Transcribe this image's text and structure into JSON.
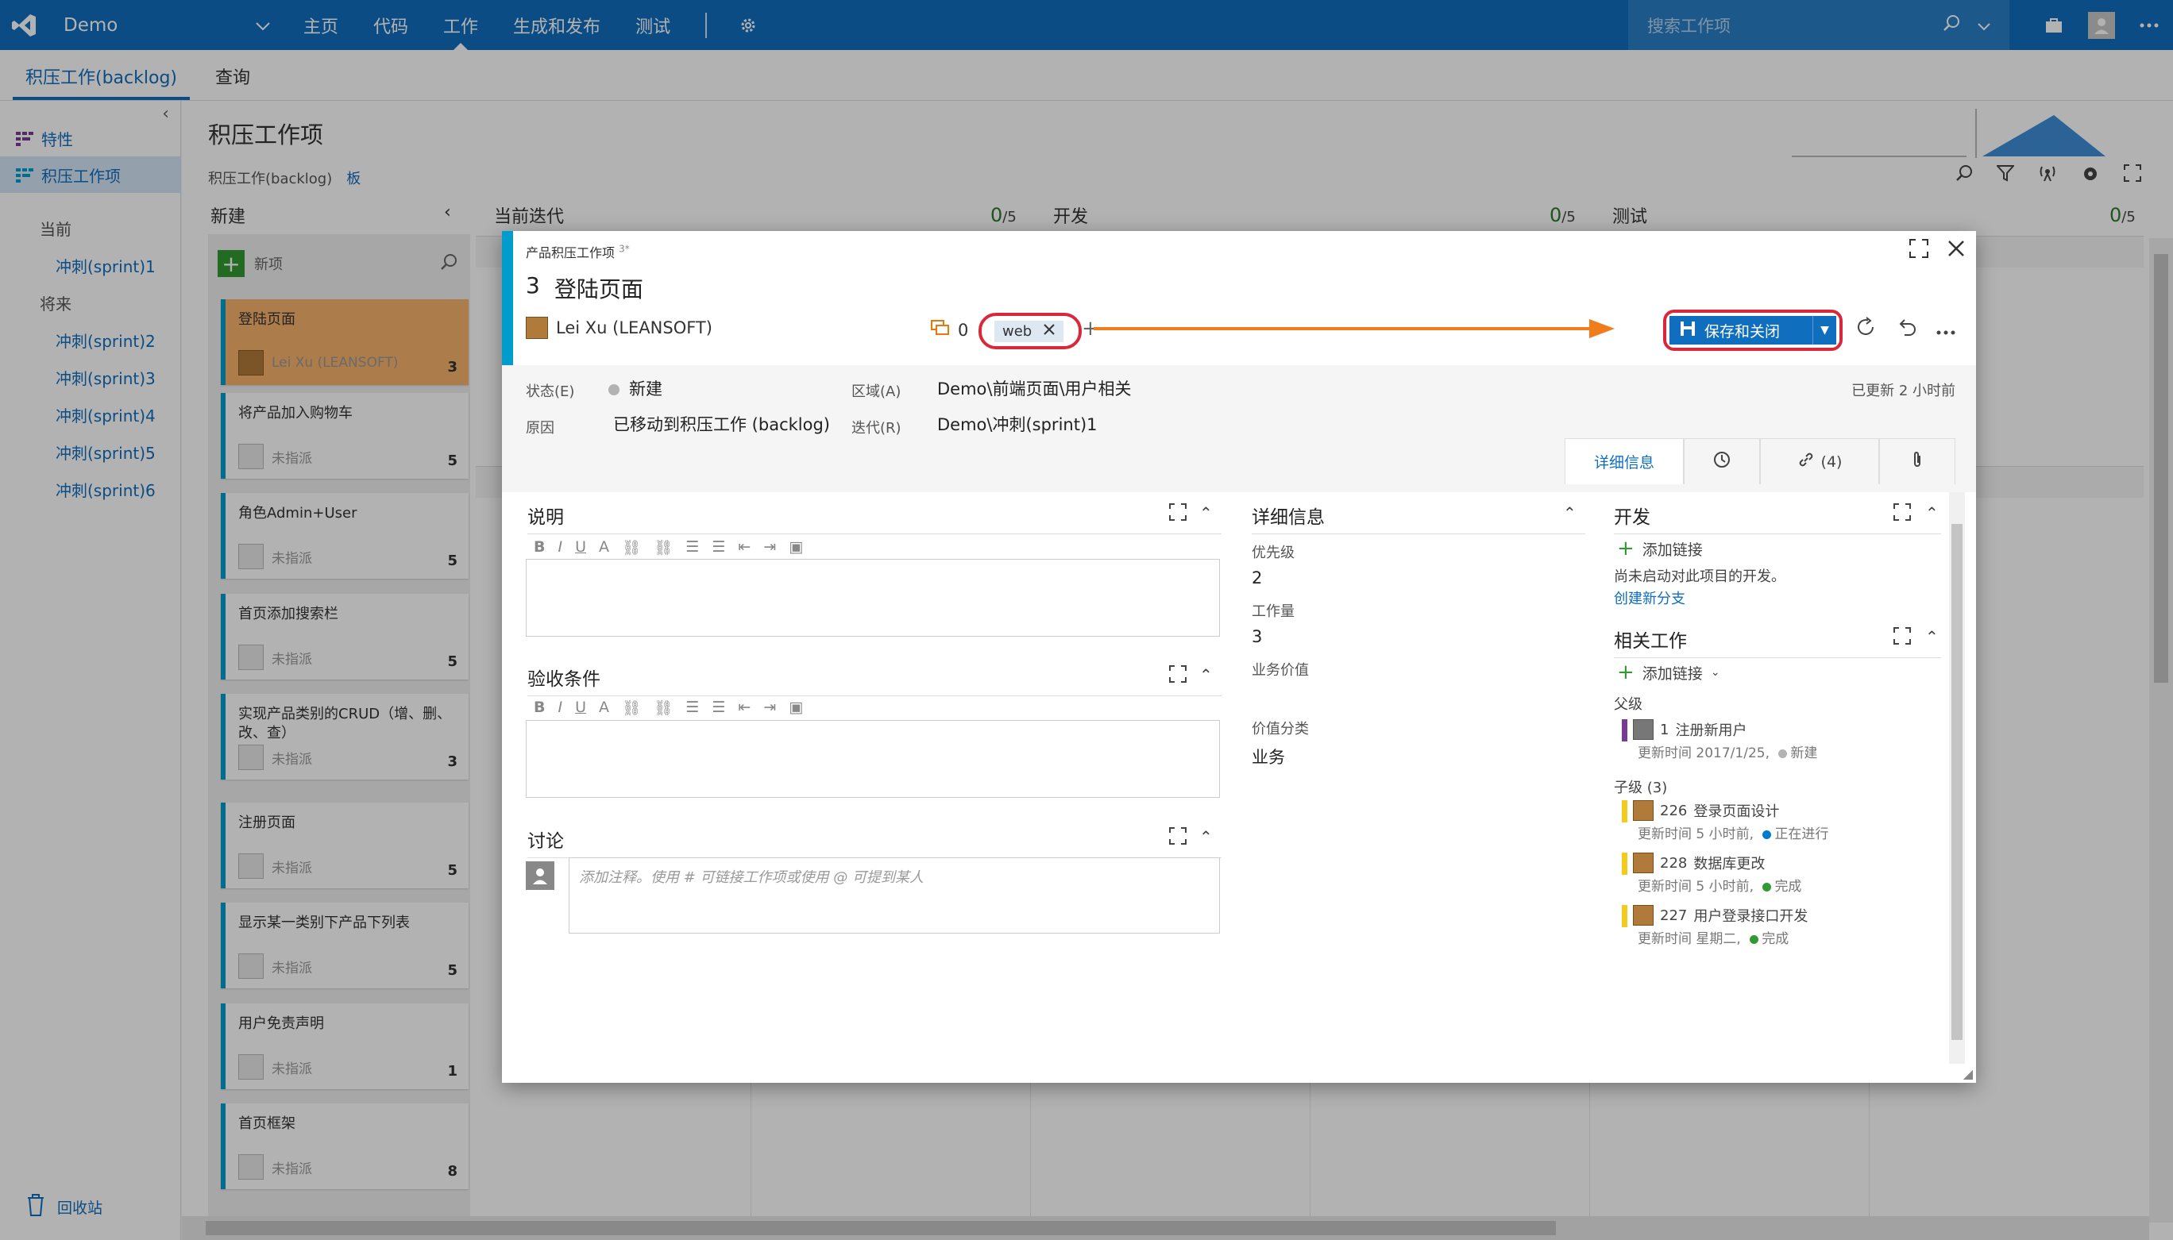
{
  "topbar": {
    "project": "Demo",
    "nav": [
      "主页",
      "代码",
      "工作",
      "生成和发布",
      "测试"
    ],
    "active_nav": "工作",
    "search_placeholder": "搜索工作项"
  },
  "hub": {
    "tabs": [
      "积压工作(backlog)",
      "查询"
    ],
    "active": "积压工作(backlog)"
  },
  "leftnav": {
    "items": [
      {
        "label": "特性",
        "selected": false
      },
      {
        "label": "积压工作项",
        "selected": true
      }
    ],
    "current_label": "当前",
    "current_sprints": [
      "冲刺(sprint)1"
    ],
    "future_label": "将来",
    "future_sprints": [
      "冲刺(sprint)2",
      "冲刺(sprint)3",
      "冲刺(sprint)4",
      "冲刺(sprint)5",
      "冲刺(sprint)6"
    ],
    "recycle": "回收站"
  },
  "board": {
    "title": "积压工作项",
    "breadcrumb": {
      "backlog": "积压工作(backlog)",
      "board": "板"
    },
    "new_column": "新建",
    "new_item": "新项",
    "columns": [
      {
        "name": "当前迭代",
        "count": "0",
        "limit": "/5"
      },
      {
        "name": "开发",
        "count": "0",
        "limit": "/5"
      },
      {
        "name": "测试",
        "count": "0",
        "limit": "/5"
      }
    ],
    "cards": [
      {
        "title": "登陆页面",
        "assignee": "Lei Xu (LEANSOFT)",
        "effort": "3",
        "highlight": true
      },
      {
        "title": "将产品加入购物车",
        "assignee": "未指派",
        "effort": "5",
        "highlight": false
      },
      {
        "title": "角色Admin+User",
        "assignee": "未指派",
        "effort": "5",
        "highlight": false
      },
      {
        "title": "首页添加搜索栏",
        "assignee": "未指派",
        "effort": "5",
        "highlight": false
      },
      {
        "title": "实现产品类别的CRUD（增、删、改、查）",
        "assignee": "未指派",
        "effort": "3",
        "highlight": false
      },
      {
        "title": "注册页面",
        "assignee": "未指派",
        "effort": "5",
        "highlight": false
      },
      {
        "title": "显示某一类别下产品下列表",
        "assignee": "未指派",
        "effort": "5",
        "highlight": false
      },
      {
        "title": "用户免责声明",
        "assignee": "未指派",
        "effort": "1",
        "highlight": false
      },
      {
        "title": "首页框架",
        "assignee": "未指派",
        "effort": "8",
        "highlight": false
      }
    ]
  },
  "dialog": {
    "type": "产品积压工作项",
    "type_sup": "3*",
    "id": "3",
    "title": "登陆页面",
    "assignee": "Lei Xu (LEANSOFT)",
    "comments": "0",
    "tag": "web",
    "save_label": "保存和关闭",
    "fields": {
      "state_label": "状态(E)",
      "state": "新建",
      "reason_label": "原因",
      "reason": "已移动到积压工作 (backlog)",
      "area_label": "区域(A)",
      "area": "Demo\\前端页面\\用户相关",
      "iteration_label": "迭代(R)",
      "iteration": "Demo\\冲刺(sprint)1"
    },
    "updated": "已更新 2 小时前",
    "tabs": {
      "details": "详细信息",
      "links": "(4)"
    },
    "sections": {
      "description": "说明",
      "acceptance": "验收条件",
      "discussion": "讨论",
      "discussion_placeholder": "添加注释。使用 # 可链接工作项或使用 @ 可提到某人"
    },
    "details": {
      "title": "详细信息",
      "priority_label": "优先级",
      "priority": "2",
      "effort_label": "工作量",
      "effort": "3",
      "business_value_label": "业务价值",
      "value_area_label": "价值分类",
      "value_area": "业务"
    },
    "development": {
      "title": "开发",
      "add_link": "添加链接",
      "no_dev": "尚未启动对此项目的开发。",
      "create_branch": "创建新分支"
    },
    "related": {
      "title": "相关工作",
      "add_link": "添加链接",
      "parent_label": "父级",
      "parent": {
        "id": "1",
        "title": "注册新用户",
        "updated": "更新时间 2017/1/25,",
        "status": "新建",
        "color": "#773b93",
        "status_color": "#b2b2b2"
      },
      "children_label": "子级 (3)",
      "children": [
        {
          "id": "226",
          "title": "登录页面设计",
          "updated": "更新时间 5 小时前,",
          "status": "正在进行",
          "color": "#f2cb1d",
          "status_color": "#007acc"
        },
        {
          "id": "228",
          "title": "数据库更改",
          "updated": "更新时间 5 小时前,",
          "status": "完成",
          "color": "#f2cb1d",
          "status_color": "#339933"
        },
        {
          "id": "227",
          "title": "用户登录接口开发",
          "updated": "更新时间 星期二,",
          "status": "完成",
          "color": "#f2cb1d",
          "status_color": "#339933"
        }
      ]
    }
  }
}
